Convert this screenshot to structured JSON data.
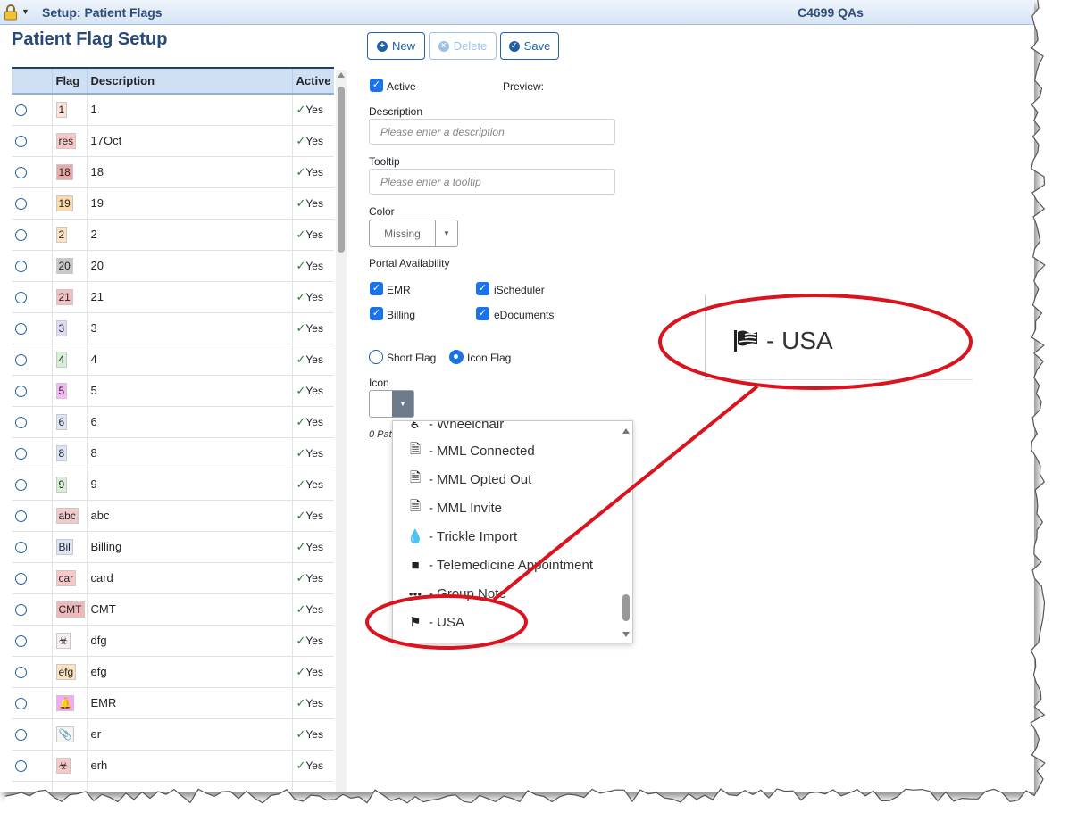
{
  "titlebar": {
    "title": "Setup: Patient Flags",
    "right_text": "C4699 QAs",
    "lock_icon": "lock-icon"
  },
  "page_title": "Patient Flag Setup",
  "table": {
    "columns": [
      "",
      "Flag",
      "Description",
      "Active"
    ],
    "rows": [
      {
        "flag": "1",
        "flag_color": "#fbe3d7",
        "description": "1",
        "active": "Yes"
      },
      {
        "flag": "res",
        "flag_color": "#f9c9c9",
        "description": "17Oct",
        "active": "Yes"
      },
      {
        "flag": "18",
        "flag_color": "#eaa9a9",
        "description": "18",
        "active": "Yes"
      },
      {
        "flag": "19",
        "flag_color": "#fbd9a8",
        "description": "19",
        "active": "Yes"
      },
      {
        "flag": "2",
        "flag_color": "#fde2c0",
        "description": "2",
        "active": "Yes"
      },
      {
        "flag": "20",
        "flag_color": "#c8c8c8",
        "description": "20",
        "active": "Yes"
      },
      {
        "flag": "21",
        "flag_color": "#f2c0c0",
        "description": "21",
        "active": "Yes"
      },
      {
        "flag": "3",
        "flag_color": "#dcdcf6",
        "description": "3",
        "active": "Yes"
      },
      {
        "flag": "4",
        "flag_color": "#d6f0d6",
        "description": "4",
        "active": "Yes"
      },
      {
        "flag": "5",
        "flag_color": "#f6b8f6",
        "description": "5",
        "active": "Yes"
      },
      {
        "flag": "6",
        "flag_color": "#dde4f5",
        "description": "6",
        "active": "Yes"
      },
      {
        "flag": "8",
        "flag_color": "#dde4f5",
        "description": "8",
        "active": "Yes"
      },
      {
        "flag": "9",
        "flag_color": "#d6f0d6",
        "description": "9",
        "active": "Yes"
      },
      {
        "flag": "abc",
        "flag_color": "#f0caca",
        "description": "abc",
        "active": "Yes"
      },
      {
        "flag": "Bil",
        "flag_color": "#dde4f5",
        "description": "Billing",
        "active": "Yes"
      },
      {
        "flag": "car",
        "flag_color": "#f9c9c9",
        "description": "card",
        "active": "Yes"
      },
      {
        "flag": "CMT",
        "flag_color": "#f0b8b8",
        "description": "CMT",
        "active": "Yes"
      },
      {
        "flag": "☣",
        "flag_color": "#f8f0f0",
        "description": "dfg",
        "active": "Yes"
      },
      {
        "flag": "efg",
        "flag_color": "#fde2c0",
        "description": "efg",
        "active": "Yes"
      },
      {
        "flag": "🔔",
        "flag_color": "#f6a8f6",
        "description": "EMR",
        "active": "Yes"
      },
      {
        "flag": "📎",
        "flag_color": "#f4f4f4",
        "description": "er",
        "active": "Yes"
      },
      {
        "flag": "☣",
        "flag_color": "#f6c9c9",
        "description": "erh",
        "active": "Yes"
      },
      {
        "flag": "",
        "flag_color": "#ffffff",
        "description": "",
        "active": ""
      }
    ]
  },
  "toolbar": {
    "new_label": "New",
    "delete_label": "Delete",
    "save_label": "Save"
  },
  "form": {
    "active_label": "Active",
    "preview_label": "Preview:",
    "description_label": "Description",
    "description_placeholder": "Please enter a description",
    "tooltip_label": "Tooltip",
    "tooltip_placeholder": "Please enter a tooltip",
    "color_label": "Color",
    "color_value": "Missing",
    "portal_label": "Portal Availability",
    "portal": {
      "emr": "EMR",
      "ischeduler": "iScheduler",
      "billing": "Billing",
      "edocuments": "eDocuments"
    },
    "short_flag_label": "Short Flag",
    "icon_flag_label": "Icon Flag",
    "icon_label": "Icon",
    "count_text": "0 Pat"
  },
  "icon_dropdown": {
    "items": [
      {
        "icon": "wheelchair-icon",
        "glyph": "♿",
        "label": "- Wheelchair"
      },
      {
        "icon": "file-check-icon",
        "glyph": "🗎",
        "label": "- MML Connected"
      },
      {
        "icon": "file-x-icon",
        "glyph": "🗎",
        "label": "- MML Opted Out"
      },
      {
        "icon": "file-plus-icon",
        "glyph": "🗎",
        "label": "- MML Invite"
      },
      {
        "icon": "hand-drop-icon",
        "glyph": "💧",
        "label": "- Trickle Import"
      },
      {
        "icon": "video-camera-icon",
        "glyph": "■",
        "label": "- Telemedicine Appointment"
      },
      {
        "icon": "users-icon",
        "glyph": "●●●",
        "label": "- Group Note"
      },
      {
        "icon": "flag-usa-icon",
        "glyph": "⚑",
        "label": "- USA"
      }
    ]
  },
  "zoom_callout": {
    "label": "- USA",
    "icon": "flag-usa-icon"
  },
  "colors": {
    "accent": "#1e5fa6",
    "annotation": "#d9141e",
    "header": "#27497a"
  }
}
